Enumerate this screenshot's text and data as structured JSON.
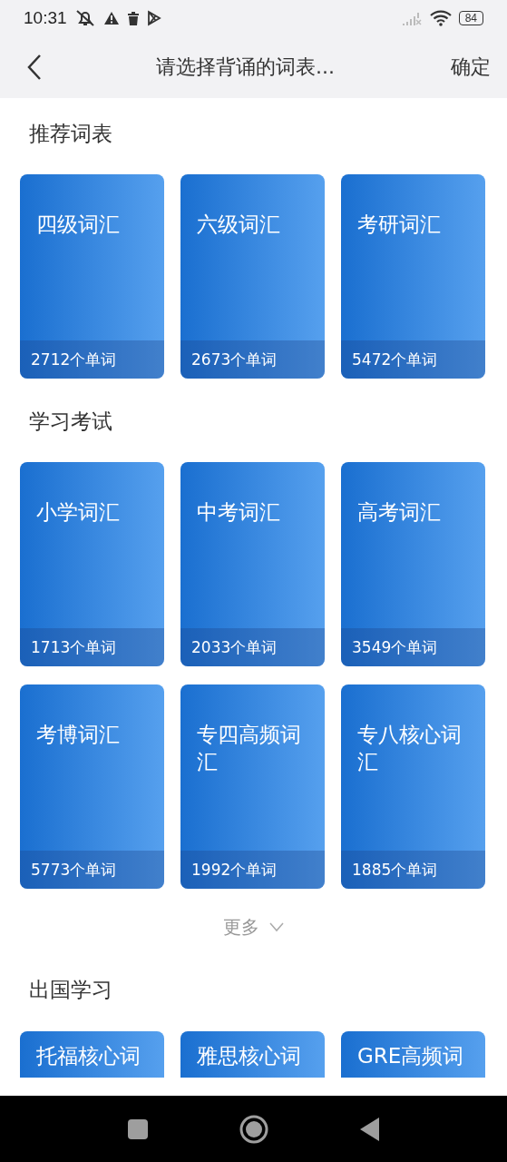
{
  "status_bar": {
    "time": "10:31",
    "battery": "84"
  },
  "header": {
    "title": "请选择背诵的词表...",
    "confirm": "确定"
  },
  "sections": [
    {
      "title": "推荐词表",
      "cards": [
        {
          "title": "四级词汇",
          "count": "2712个单词"
        },
        {
          "title": "六级词汇",
          "count": "2673个单词"
        },
        {
          "title": "考研词汇",
          "count": "5472个单词"
        }
      ]
    },
    {
      "title": "学习考试",
      "cards": [
        {
          "title": "小学词汇",
          "count": "1713个单词"
        },
        {
          "title": "中考词汇",
          "count": "2033个单词"
        },
        {
          "title": "高考词汇",
          "count": "3549个单词"
        },
        {
          "title": "考博词汇",
          "count": "5773个单词"
        },
        {
          "title": "专四高频词汇",
          "count": "1992个单词"
        },
        {
          "title": "专八核心词汇",
          "count": "1885个单词"
        }
      ],
      "more": "更多"
    },
    {
      "title": "出国学习",
      "cards": [
        {
          "title": "托福核心词"
        },
        {
          "title": "雅思核心词"
        },
        {
          "title": "GRE高频词"
        }
      ]
    }
  ]
}
